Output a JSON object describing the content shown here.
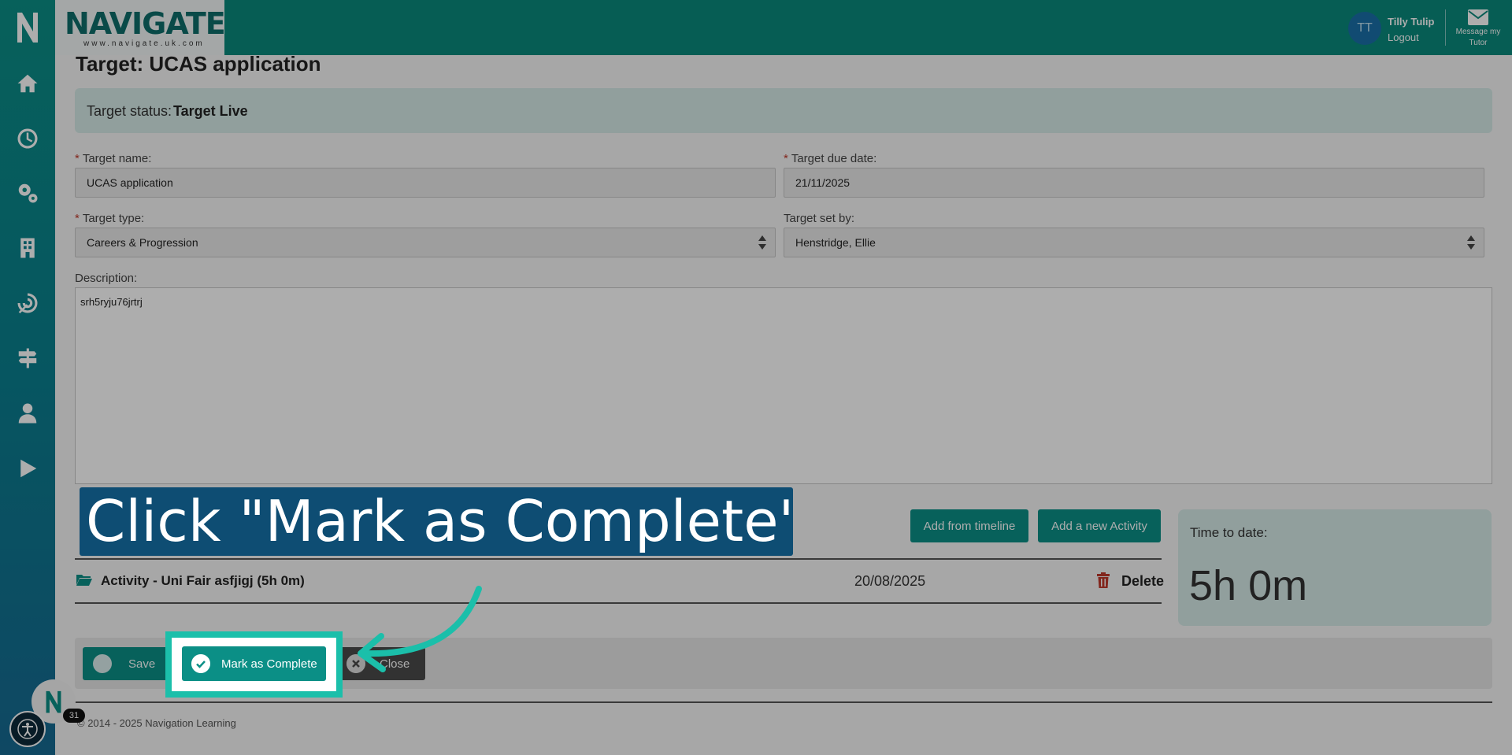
{
  "header": {
    "brand_word": "NAVIGATE",
    "brand_url": "www.navigate.uk.com",
    "user_initials": "TT",
    "user_name": "Tilly Tulip",
    "logout_label": "Logout",
    "message_label": "Message my Tutor"
  },
  "sidebar": {
    "items": [
      {
        "icon": "home-icon"
      },
      {
        "icon": "clock-icon"
      },
      {
        "icon": "gears-icon"
      },
      {
        "icon": "building-icon"
      },
      {
        "icon": "target-icon"
      },
      {
        "icon": "signpost-icon"
      },
      {
        "icon": "user-icon"
      },
      {
        "icon": "play-icon"
      }
    ]
  },
  "page": {
    "title": "Target: UCAS application",
    "status_label": "Target status:",
    "status_value": "Target Live"
  },
  "form": {
    "target_name_label": "Target name:",
    "target_name_value": "UCAS application",
    "due_date_label": "Target due date:",
    "due_date_value": "21/11/2025",
    "target_type_label": "Target type:",
    "target_type_value": "Careers & Progression",
    "set_by_label": "Target set by:",
    "set_by_value": "Henstridge, Ellie",
    "description_label": "Description:",
    "description_value": "srh5ryju76jrtrj"
  },
  "activities": {
    "add_from_timeline_label": "Add from timeline",
    "add_new_activity_label": "Add a new Activity",
    "rows": [
      {
        "title": "Activity - Uni Fair asfjigj (5h 0m)",
        "date": "20/08/2025",
        "delete_label": "Delete"
      }
    ]
  },
  "time_card": {
    "label": "Time to date:",
    "value": "5h 0m"
  },
  "actions": {
    "save_label": "Save",
    "mark_complete_label": "Mark as Complete",
    "close_label": "Close"
  },
  "footer": {
    "text": "© 2014 - 2025 Navigation Learning"
  },
  "notifications": {
    "count": "31"
  },
  "tutorial": {
    "callout_text": "Click \"Mark as Complete\"",
    "highlight_color": "#1bbfaa",
    "callout_color": "#0e4d73"
  },
  "colors": {
    "brand_teal": "#0b8f86",
    "header_teal": "#0a8a7d",
    "status_bg": "#d6ebe8",
    "required": "#c0392b"
  }
}
